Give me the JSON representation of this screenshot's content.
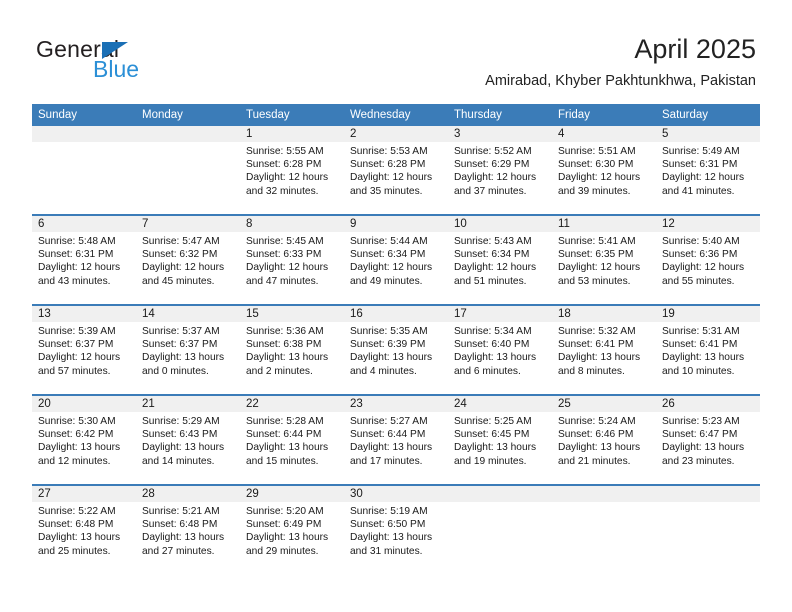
{
  "brand": {
    "name_part1": "General",
    "name_part2": "Blue",
    "logo_icon": "triangle-flag-icon"
  },
  "header": {
    "title": "April 2025",
    "location": "Amirabad, Khyber Pakhtunkhwa, Pakistan"
  },
  "colors": {
    "header_blue": "#3b7cb8",
    "brand_blue": "#2b8fd6",
    "daynum_band": "#f0f0f0",
    "text": "#1a1a1a"
  },
  "weekdays": [
    "Sunday",
    "Monday",
    "Tuesday",
    "Wednesday",
    "Thursday",
    "Friday",
    "Saturday"
  ],
  "labels": {
    "sunrise": "Sunrise:",
    "sunset": "Sunset:",
    "daylight": "Daylight:"
  },
  "weeks": [
    [
      {
        "day": "",
        "sunrise": "",
        "sunset": "",
        "daylight": "",
        "empty": true
      },
      {
        "day": "",
        "sunrise": "",
        "sunset": "",
        "daylight": "",
        "empty": true
      },
      {
        "day": "1",
        "sunrise": "Sunrise: 5:55 AM",
        "sunset": "Sunset: 6:28 PM",
        "daylight": "Daylight: 12 hours and 32 minutes."
      },
      {
        "day": "2",
        "sunrise": "Sunrise: 5:53 AM",
        "sunset": "Sunset: 6:28 PM",
        "daylight": "Daylight: 12 hours and 35 minutes."
      },
      {
        "day": "3",
        "sunrise": "Sunrise: 5:52 AM",
        "sunset": "Sunset: 6:29 PM",
        "daylight": "Daylight: 12 hours and 37 minutes."
      },
      {
        "day": "4",
        "sunrise": "Sunrise: 5:51 AM",
        "sunset": "Sunset: 6:30 PM",
        "daylight": "Daylight: 12 hours and 39 minutes."
      },
      {
        "day": "5",
        "sunrise": "Sunrise: 5:49 AM",
        "sunset": "Sunset: 6:31 PM",
        "daylight": "Daylight: 12 hours and 41 minutes."
      }
    ],
    [
      {
        "day": "6",
        "sunrise": "Sunrise: 5:48 AM",
        "sunset": "Sunset: 6:31 PM",
        "daylight": "Daylight: 12 hours and 43 minutes."
      },
      {
        "day": "7",
        "sunrise": "Sunrise: 5:47 AM",
        "sunset": "Sunset: 6:32 PM",
        "daylight": "Daylight: 12 hours and 45 minutes."
      },
      {
        "day": "8",
        "sunrise": "Sunrise: 5:45 AM",
        "sunset": "Sunset: 6:33 PM",
        "daylight": "Daylight: 12 hours and 47 minutes."
      },
      {
        "day": "9",
        "sunrise": "Sunrise: 5:44 AM",
        "sunset": "Sunset: 6:34 PM",
        "daylight": "Daylight: 12 hours and 49 minutes."
      },
      {
        "day": "10",
        "sunrise": "Sunrise: 5:43 AM",
        "sunset": "Sunset: 6:34 PM",
        "daylight": "Daylight: 12 hours and 51 minutes."
      },
      {
        "day": "11",
        "sunrise": "Sunrise: 5:41 AM",
        "sunset": "Sunset: 6:35 PM",
        "daylight": "Daylight: 12 hours and 53 minutes."
      },
      {
        "day": "12",
        "sunrise": "Sunrise: 5:40 AM",
        "sunset": "Sunset: 6:36 PM",
        "daylight": "Daylight: 12 hours and 55 minutes."
      }
    ],
    [
      {
        "day": "13",
        "sunrise": "Sunrise: 5:39 AM",
        "sunset": "Sunset: 6:37 PM",
        "daylight": "Daylight: 12 hours and 57 minutes."
      },
      {
        "day": "14",
        "sunrise": "Sunrise: 5:37 AM",
        "sunset": "Sunset: 6:37 PM",
        "daylight": "Daylight: 13 hours and 0 minutes."
      },
      {
        "day": "15",
        "sunrise": "Sunrise: 5:36 AM",
        "sunset": "Sunset: 6:38 PM",
        "daylight": "Daylight: 13 hours and 2 minutes."
      },
      {
        "day": "16",
        "sunrise": "Sunrise: 5:35 AM",
        "sunset": "Sunset: 6:39 PM",
        "daylight": "Daylight: 13 hours and 4 minutes."
      },
      {
        "day": "17",
        "sunrise": "Sunrise: 5:34 AM",
        "sunset": "Sunset: 6:40 PM",
        "daylight": "Daylight: 13 hours and 6 minutes."
      },
      {
        "day": "18",
        "sunrise": "Sunrise: 5:32 AM",
        "sunset": "Sunset: 6:41 PM",
        "daylight": "Daylight: 13 hours and 8 minutes."
      },
      {
        "day": "19",
        "sunrise": "Sunrise: 5:31 AM",
        "sunset": "Sunset: 6:41 PM",
        "daylight": "Daylight: 13 hours and 10 minutes."
      }
    ],
    [
      {
        "day": "20",
        "sunrise": "Sunrise: 5:30 AM",
        "sunset": "Sunset: 6:42 PM",
        "daylight": "Daylight: 13 hours and 12 minutes."
      },
      {
        "day": "21",
        "sunrise": "Sunrise: 5:29 AM",
        "sunset": "Sunset: 6:43 PM",
        "daylight": "Daylight: 13 hours and 14 minutes."
      },
      {
        "day": "22",
        "sunrise": "Sunrise: 5:28 AM",
        "sunset": "Sunset: 6:44 PM",
        "daylight": "Daylight: 13 hours and 15 minutes."
      },
      {
        "day": "23",
        "sunrise": "Sunrise: 5:27 AM",
        "sunset": "Sunset: 6:44 PM",
        "daylight": "Daylight: 13 hours and 17 minutes."
      },
      {
        "day": "24",
        "sunrise": "Sunrise: 5:25 AM",
        "sunset": "Sunset: 6:45 PM",
        "daylight": "Daylight: 13 hours and 19 minutes."
      },
      {
        "day": "25",
        "sunrise": "Sunrise: 5:24 AM",
        "sunset": "Sunset: 6:46 PM",
        "daylight": "Daylight: 13 hours and 21 minutes."
      },
      {
        "day": "26",
        "sunrise": "Sunrise: 5:23 AM",
        "sunset": "Sunset: 6:47 PM",
        "daylight": "Daylight: 13 hours and 23 minutes."
      }
    ],
    [
      {
        "day": "27",
        "sunrise": "Sunrise: 5:22 AM",
        "sunset": "Sunset: 6:48 PM",
        "daylight": "Daylight: 13 hours and 25 minutes."
      },
      {
        "day": "28",
        "sunrise": "Sunrise: 5:21 AM",
        "sunset": "Sunset: 6:48 PM",
        "daylight": "Daylight: 13 hours and 27 minutes."
      },
      {
        "day": "29",
        "sunrise": "Sunrise: 5:20 AM",
        "sunset": "Sunset: 6:49 PM",
        "daylight": "Daylight: 13 hours and 29 minutes."
      },
      {
        "day": "30",
        "sunrise": "Sunrise: 5:19 AM",
        "sunset": "Sunset: 6:50 PM",
        "daylight": "Daylight: 13 hours and 31 minutes."
      },
      {
        "day": "",
        "sunrise": "",
        "sunset": "",
        "daylight": "",
        "empty": true
      },
      {
        "day": "",
        "sunrise": "",
        "sunset": "",
        "daylight": "",
        "empty": true
      },
      {
        "day": "",
        "sunrise": "",
        "sunset": "",
        "daylight": "",
        "empty": true
      }
    ]
  ]
}
